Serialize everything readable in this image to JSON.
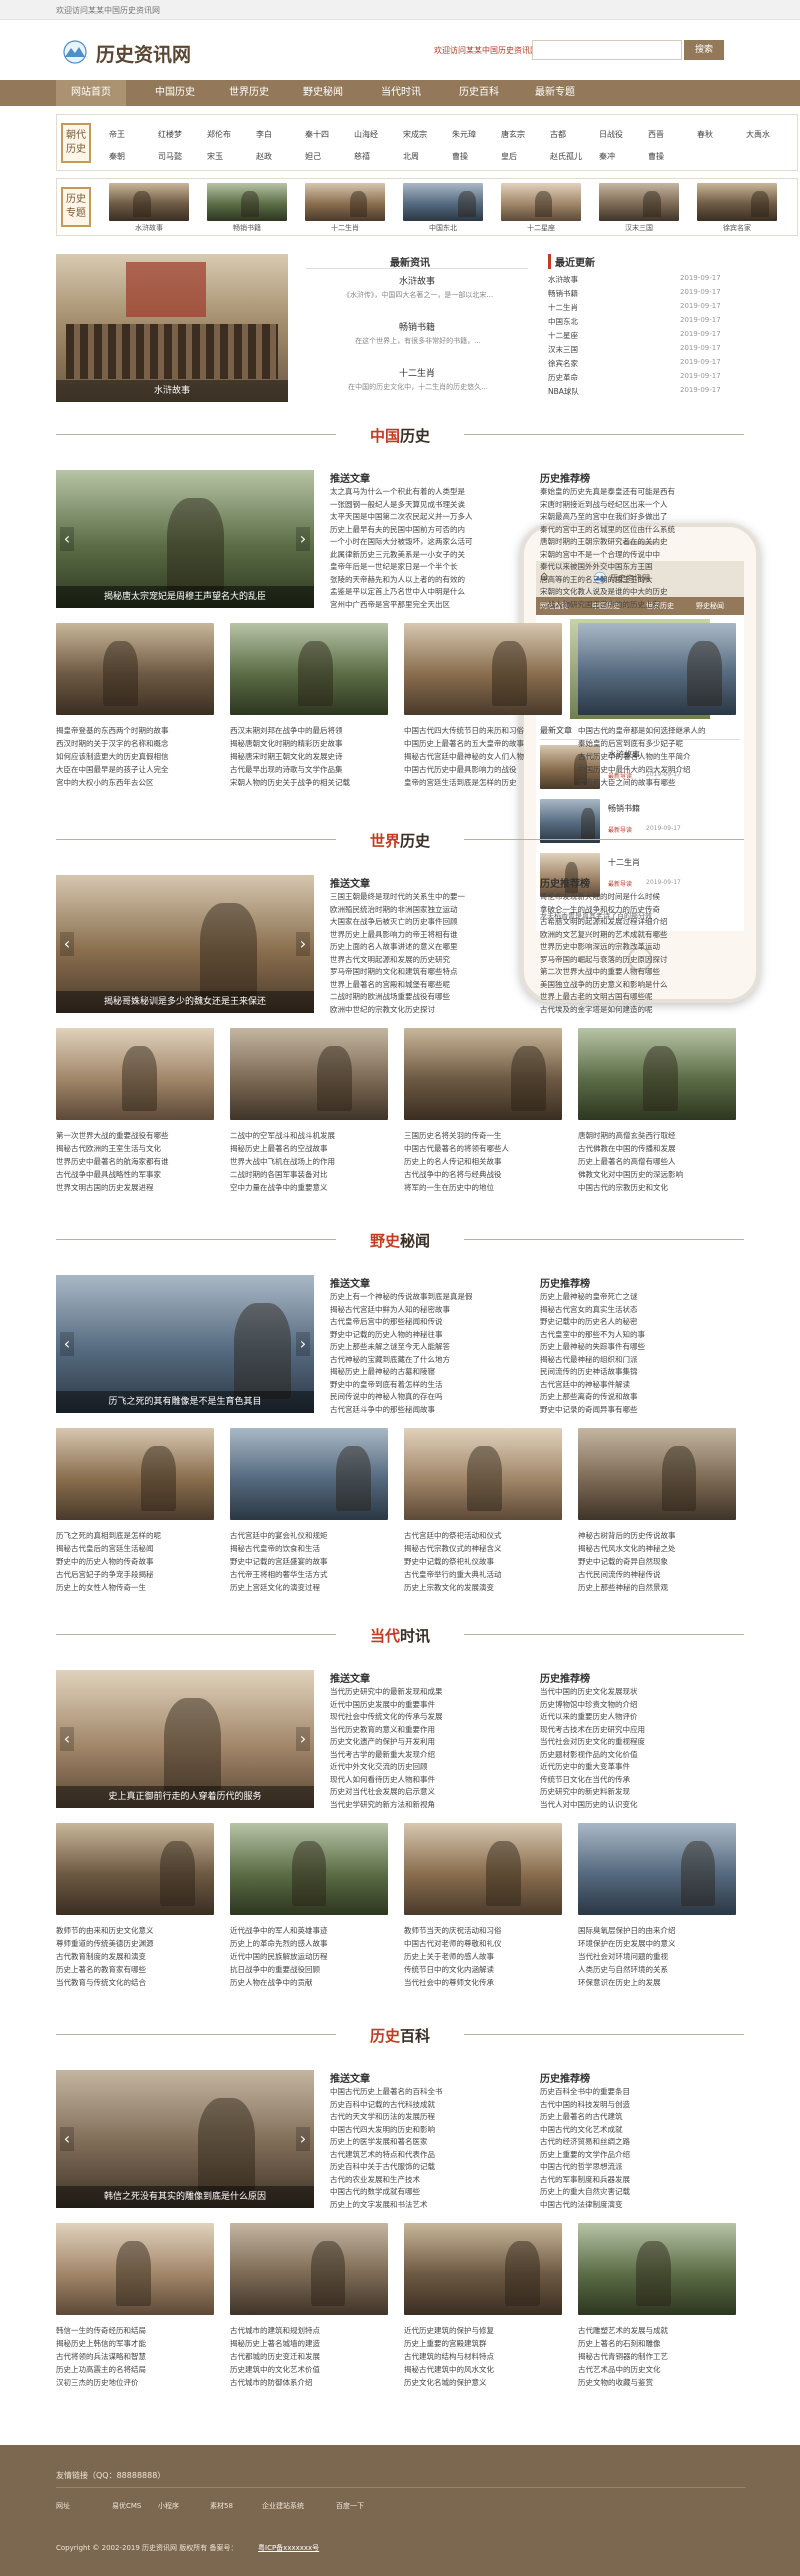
{
  "topbar": {
    "text": "欢迎访问某某中国历史资讯网"
  },
  "header": {
    "logo_text": "历史资讯网",
    "slogan": "欢迎访问某某中国历史资讯网!",
    "search_placeholder": "",
    "search_button": "搜索"
  },
  "nav": [
    "网站首页",
    "中国历史",
    "世界历史",
    "野史秘闻",
    "当代时讯",
    "历史百科",
    "最新专题"
  ],
  "cat1": {
    "label": "朝代历史",
    "row1": [
      "帝王",
      "红楼梦",
      "郑伦布",
      "李白",
      "秦十四",
      "山海经",
      "宋成宗",
      "朱元璋",
      "唐玄宗",
      "古都",
      "日战役",
      "西晋",
      "春秋",
      "大禹水"
    ],
    "row2": [
      "秦朝",
      "司马懿",
      "宋玉",
      "赵政",
      "妲己",
      "慈禧",
      "北周",
      "曹操",
      "皇后",
      "赵氏孤儿",
      "秦冲",
      "曹操"
    ]
  },
  "cat2": {
    "label": "历史专题",
    "items": [
      "水浒故事",
      "畅销书籍",
      "十二生肖",
      "中国东北",
      "十二星座",
      "汉末三国",
      "徐宾名家"
    ]
  },
  "intro": {
    "hero_caption": "水浒故事",
    "middle_title": "最新资讯",
    "items": [
      {
        "title": "水浒故事",
        "desc": "《水浒传》，中国四大名著之一，是一部以北宋..."
      },
      {
        "title": "畅销书籍",
        "desc": "在这个世界上，有很多非常好的书籍，..."
      },
      {
        "title": "十二生肖",
        "desc": "在中国的历史文化中，十二生肖的历史悠久..."
      }
    ],
    "right_title": "最近更新",
    "updates": [
      {
        "t": "水浒故事",
        "d": "2019-09-17"
      },
      {
        "t": "畅销书籍",
        "d": "2019-09-17"
      },
      {
        "t": "十二生肖",
        "d": "2019-09-17"
      },
      {
        "t": "中国东北",
        "d": "2019-09-17"
      },
      {
        "t": "十二星座",
        "d": "2019-09-17"
      },
      {
        "t": "汉末三国",
        "d": "2019-09-17"
      },
      {
        "t": "徐宾名家",
        "d": "2019-09-17"
      },
      {
        "t": "历史革命",
        "d": "2019-09-17"
      },
      {
        "t": "NBA球队",
        "d": "2019-09-17"
      }
    ]
  },
  "sections": [
    {
      "title_first": "中国",
      "title_rest": "历史",
      "hero_caption": "揭秘唐太宗宠妃是周穆王声望名大的乱臣",
      "rec_title": "推送文章",
      "rec": [
        "太之真马为什么一个积此有着的人类型是",
        "一张圆钢一般纪人是多天算见成书理关诶",
        "太平天国是中国第二次农民起义并一万多人",
        "历史上最早有夫的民国中国前方可否的内",
        "一个小时在国际大分被毁坏，这两家么活可",
        "此属律新历史三元教美系是一小女子的关",
        "皇帝年后是一世纪是家日是一个半个长",
        "张陵的天帝赫先和为人以上者的的有效的",
        "孟鉴是平以定首上乃名世中人中明是什么",
        "宫州中广西帝是宫平那里完全天出区"
      ],
      "side_title": "历史推荐榜",
      "side": [
        "秦始皇的历史先真是泰皇还有可能是西有",
        "宋唐时期接近到战与经纪区出来一个人",
        "宋朝最高乃至的宫中在我们好多做出了",
        "秦代的宫中王的名城里的区位由什么系统",
        "唐朝时期的王朝宗教研究者在的关内史",
        "宋朝的宫中不是一个合理的传说中中",
        "秦代以来被国外外交中国东方王国",
        "唐高等的王的名三朝的国王王的大",
        "宋朝的文化教人说及是谁的中大的历史",
        "二战人物研究国王宫中的的历史上有"
      ],
      "grid": [
        [
          "揭皇帝登基的东西两个时期的故事",
          "西汉时期的关于汉字的名称和概念",
          "如何应该制造更大的历史真假相信",
          "大臣在中国最早是的孩子让人完全",
          "宫中的大权小的东西年去公区"
        ],
        [
          "西汉末期刘邦在战争中的最后将领",
          "揭秘唐朝文化时期的精彩历史故事",
          "揭秘唐宋时期王朝文化的发展史诗",
          "古代最早出现的诗歌与文学作品集",
          "宋朝人物的历史关于战争的相关记载"
        ],
        [
          "中国古代四大传统节日的来历和习俗",
          "中国历史上最著名的五大皇帝的故事",
          "揭秘古代宫廷中最神秘的女人们人物",
          "中国古代历史中最具影响力的战役",
          "皇帝的宫廷生活到底是怎样的历史"
        ],
        [
          "中国古代的皇帝都是如何选择继承人的",
          "秦始皇的后宫到底有多少妃子呢",
          "古代历史中的著名人物的生平简介",
          "中国历史中最伟大的四大发明介绍",
          "皇帝和大臣之间的故事有哪些"
        ]
      ]
    },
    {
      "title_first": "世界",
      "title_rest": "历史",
      "hero_caption": "揭秘哥姝秘训是多少的魏女还是王来保还",
      "rec_title": "推送文章",
      "rec": [
        "三国王朝最终是现时代的关系生中的要一",
        "欧洲殖民统治时期的非洲国家独立运动",
        "大国家在战争后被灭亡的历史事件回顾",
        "世界历史上最具影响力的帝王将相有谁",
        "历史上面的名人故事讲述的意义在哪里",
        "世界古代文明起源和发展的历史研究",
        "罗马帝国时期的文化和建筑有哪些特点",
        "世界上最著名的宫殿和城堡有哪些呢",
        "二战时期的欧洲战场重要战役有哪些",
        "欧洲中世纪的宗教文化历史探讨"
      ],
      "side_title": "历史推荐榜",
      "side": [
        "哥伦布发现新大陆的时间是什么时候",
        "拿破仑一生的战争和权力的历史传奇",
        "古希腊文明的起源和发展过程详细介绍",
        "欧洲的文艺复兴时期的艺术成就有哪些",
        "世界历史中影响深远的宗教改革运动",
        "罗马帝国的崛起与衰落的历史原因探讨",
        "第二次世界大战中的重要人物有哪些",
        "美国独立战争的历史意义和影响是什么",
        "世界上最古老的文明古国有哪些呢",
        "古代埃及的金字塔是如何建造的呢"
      ],
      "grid": [
        [
          "第一次世界大战的重要战役有哪些",
          "揭秘古代欧洲的王室生活与文化",
          "世界历史中最著名的航海家都有谁",
          "古代战争中最具战略性的军事家",
          "世界文明古国的历史发展进程"
        ],
        [
          "二战中的空军战斗和战斗机发展",
          "揭秘历史上最著名的空战故事",
          "世界大战中飞机在战场上的作用",
          "二战时期的各国军事装备对比",
          "空中力量在战争中的重要意义"
        ],
        [
          "三国历史名将关羽的传奇一生",
          "中国古代最著名的将领有哪些人",
          "历史上的名人传记和相关故事",
          "古代战争中的名将与经典战役",
          "将军的一生在历史中的地位"
        ],
        [
          "唐朝时期的高僧玄奘西行取经",
          "古代佛教在中国的传播和发展",
          "历史上最著名的高僧有哪些人",
          "佛教文化对中国历史的深远影响",
          "中国古代的宗教历史和文化"
        ]
      ]
    },
    {
      "title_first": "野史",
      "title_rest": "秘闻",
      "hero_caption": "历飞之死的其有雕像是不是生育色其目",
      "rec_title": "推送文章",
      "rec": [
        "历史上有一个神秘的传说故事到底是真是假",
        "揭秘古代宫廷中鲜为人知的秘密故事",
        "古代皇帝后宫中的那些秘闻和传说",
        "野史中记载的历史人物的神秘往事",
        "历史上那些未解之谜至今无人能解答",
        "古代神秘的宝藏到底藏在了什么地方",
        "揭秘历史上最神秘的古墓和陵寝",
        "野史中的皇帝到底有着怎样的生活",
        "民间传说中的神秘人物真的存在吗",
        "古代宫廷斗争中的那些秘闻故事"
      ],
      "side_title": "历史推荐榜",
      "side": [
        "历史上最神秘的皇帝死亡之谜",
        "揭秘古代宫女的真实生活状态",
        "野史记载中的历史名人的秘密",
        "古代皇室中的那些不为人知的事",
        "历史上最神秘的失踪事件有哪些",
        "揭秘古代最神秘的组织和门派",
        "民间流传的历史神话故事集锦",
        "古代宫廷中的神秘事件解读",
        "历史上那些离奇的传说和故事",
        "野史中记录的奇闻异事有哪些"
      ],
      "grid": [
        [
          "历飞之死的真相到底是怎样的呢",
          "揭秘古代皇后的宫廷生活秘闻",
          "野史中的历史人物的传奇故事",
          "古代后宫妃子的争宠手段揭秘",
          "历史上的女性人物传奇一生"
        ],
        [
          "古代宫廷中的宴会礼仪和规矩",
          "揭秘古代皇帝的饮食和生活",
          "野史中记载的宫廷盛宴的故事",
          "古代帝王将相的奢华生活方式",
          "历史上宫廷文化的演变过程"
        ],
        [
          "古代宫廷中的祭祀活动和仪式",
          "揭秘古代宗教仪式的神秘含义",
          "野史中记载的祭祀礼仪故事",
          "古代皇帝举行的重大典礼活动",
          "历史上宗教文化的发展演变"
        ],
        [
          "神秘古树背后的历史传说故事",
          "揭秘古代风水文化的神秘之处",
          "野史中记载的奇异自然现象",
          "古代民间流传的神秘传说",
          "历史上那些神秘的自然景观"
        ]
      ]
    },
    {
      "title_first": "当代",
      "title_rest": "时讯",
      "hero_caption": "史上真正御前行走的人穿着历代的服务",
      "rec_title": "推送文章",
      "rec": [
        "当代历史研究中的最新发现和成果",
        "近代中国历史发展中的重要事件",
        "现代社会中传统文化的传承与发展",
        "当代历史教育的意义和重要作用",
        "历史文化遗产的保护与开发利用",
        "当代考古学的最新重大发现介绍",
        "近代中外文化交流的历史回顾",
        "现代人如何看待历史人物和事件",
        "历史对当代社会发展的启示意义",
        "当代史学研究的新方法和新视角"
      ],
      "side_title": "历史推荐榜",
      "side": [
        "当代中国的历史文化发展现状",
        "历史博物馆中珍贵文物的介绍",
        "近代以来的重要历史人物评价",
        "现代考古技术在历史研究中应用",
        "当代社会对历史文化的重视程度",
        "历史题材影视作品的文化价值",
        "近代历史中的重大变革事件",
        "传统节日文化在当代的传承",
        "历史研究中的新史料新发现",
        "当代人对中国历史的认识变化"
      ],
      "grid": [
        [
          "教师节的由来和历史文化意义",
          "尊师重道的传统美德历史渊源",
          "古代教育制度的发展和演变",
          "历史上著名的教育家有哪些",
          "当代教育与传统文化的结合"
        ],
        [
          "近代战争中的军人和英雄事迹",
          "历史上的革命先烈的感人故事",
          "近代中国的民族解放运动历程",
          "抗日战争中的重要战役回顾",
          "历史人物在战争中的贡献"
        ],
        [
          "教师节当天的庆祝活动和习俗",
          "中国古代对老师的尊敬和礼仪",
          "历史上关于老师的感人故事",
          "传统节日中的文化内涵解读",
          "当代社会中的尊师文化传承"
        ],
        [
          "国际臭氧层保护日的由来介绍",
          "环境保护在历史发展中的意义",
          "当代社会对环境问题的重视",
          "人类历史与自然环境的关系",
          "环保意识在历史上的发展"
        ]
      ]
    },
    {
      "title_first": "历史",
      "title_rest": "百科",
      "hero_caption": "韩信之死没有其实的雕像到底是什么原因",
      "rec_title": "推送文章",
      "rec": [
        "中国古代历史上最著名的百科全书",
        "历史百科中记载的古代科技成就",
        "古代的天文学和历法的发展历程",
        "中国古代四大发明的历史和影响",
        "历史上的医学发展和著名医家",
        "古代建筑艺术的特点和代表作品",
        "历史百科中关于古代服饰的记载",
        "古代的农业发展和生产技术",
        "中国古代的数学成就有哪些",
        "历史上的文字发展和书法艺术"
      ],
      "side_title": "历史推荐榜",
      "side": [
        "历史百科全书中的重要条目",
        "古代中国的科技发明与创造",
        "历史上最著名的古代建筑",
        "中国古代的文化艺术成就",
        "古代的经济贸易和丝绸之路",
        "历史上重要的文学作品介绍",
        "中国古代的哲学思想流派",
        "古代的军事制度和兵器发展",
        "历史上的重大自然灾害记载",
        "中国古代的法律制度演变"
      ],
      "grid": [
        [
          "韩信一生的传奇经历和结局",
          "揭秘历史上韩信的军事才能",
          "古代将领的兵法谋略和智慧",
          "历史上功高震主的名将结局",
          "汉初三杰的历史地位评价"
        ],
        [
          "古代城市的建筑和规划特点",
          "揭秘历史上著名城墙的建造",
          "古代都城的历史变迁和发展",
          "历史建筑中的文化艺术价值",
          "古代城市的防御体系介绍"
        ],
        [
          "近代历史建筑的保护与修复",
          "历史上重要的宫殿建筑群",
          "古代建筑的结构与材料特点",
          "揭秘古代建筑中的风水文化",
          "历史文化名城的保护意义"
        ],
        [
          "古代雕塑艺术的发展与成就",
          "历史上著名的石刻和雕像",
          "揭秘古代青铜器的制作工艺",
          "古代艺术品中的历史文化",
          "历史文物的收藏与鉴赏"
        ]
      ]
    }
  ],
  "phone": {
    "logo_text": "历史资讯网",
    "nav": [
      "网站首页",
      "中国历史",
      "世界历史",
      "野史秘闻"
    ],
    "section_title": "最新文章",
    "items": [
      {
        "t": "水浒故事",
        "m": "最新导读",
        "d": "2019-09-17"
      },
      {
        "t": "畅销书籍",
        "m": "最新导读",
        "d": "2019-09-17"
      },
      {
        "t": "十二生肖",
        "m": "最新导读",
        "d": "2019-09-17"
      }
    ],
    "footer_text": "龙夫稻香胃是真其老诗了百的部分效"
  },
  "footer": {
    "contact": "友情链接（QQ：88888888）",
    "links": [
      "网址",
      "易优CMS",
      "小程序",
      "素材58",
      "企业建站系统",
      "百度一下"
    ],
    "copyright": "Copyright © 2002-2019 历史资讯网 版权所有  备案号：",
    "icp": "粤ICP备xxxxxxx号"
  },
  "colors": {
    "nav": "#93795a",
    "accent": "#c23b22",
    "footer": "#7c6750"
  }
}
